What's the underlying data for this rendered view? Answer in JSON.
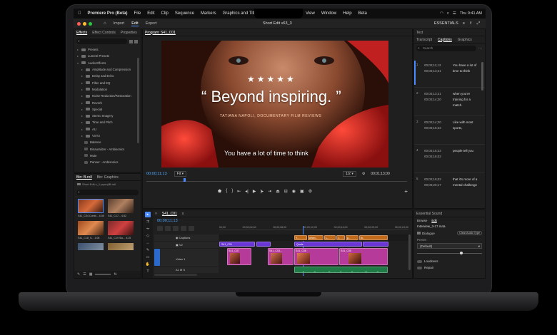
{
  "menubar": {
    "app": "Premiere Pro (Beta)",
    "items": [
      "File",
      "Edit",
      "Clip",
      "Sequence",
      "Markers",
      "Graphics and Titles",
      "View",
      "Window",
      "Help",
      "Beta"
    ],
    "clock": "Thu 9:41 AM",
    "essentials": "ESSENTIALS"
  },
  "titlebar": {
    "tabs": [
      "Import",
      "Edit",
      "Export"
    ],
    "document": "Short Edit v63_3"
  },
  "effects": {
    "tabs": [
      "Effects",
      "Effect Controls",
      "Properties"
    ],
    "search_placeholder": "",
    "tree": [
      "Presets",
      "Lumetri Presets",
      "Audio Effects",
      "Amplitude and Compression",
      "Delay and Echo",
      "Filter and EQ",
      "Modulation",
      "Noise Reduction/Restoration",
      "Reverb",
      "Special",
      "Stereo Imagery",
      "Time and Pitch",
      "AU",
      "VST3",
      "Balance",
      "Binauralizer - Ambisonics",
      "Mute",
      "Panner - Ambisonics"
    ]
  },
  "bins": {
    "tabs": [
      "Bin: B-roll",
      "Bin: Graphics"
    ],
    "path": "Short Edit v_1.prproj\\B-roll",
    "clips": [
      {
        "name": "S41_C04 Comb...",
        "dur": "4:08"
      },
      {
        "name": "S41_C17...",
        "dur": "4:52"
      },
      {
        "name": "S41_C18_S...",
        "dur": "1:06"
      },
      {
        "name": "S41_C19 Slo...",
        "dur": "4:15"
      },
      {
        "name": "S41_C22...",
        "dur": ""
      },
      {
        "name": "S41_C23...",
        "dur": ""
      }
    ]
  },
  "program": {
    "tab": "Program: S41_C01",
    "stars": "★★★★★",
    "headline": "“ Beyond inspiring. ”",
    "subline": "TATIANA NAPOLI, DOCUMENTARY FILM REVIEWS",
    "caption": "You have a lot of time to think",
    "timecode_in": "00;00;11;13",
    "fit": "Fit",
    "resolution": "1/2",
    "timecode_dur": "00;01;13;00"
  },
  "timeline": {
    "tab": "S41_C01",
    "timecode": "00;00;11;13",
    "ruler": [
      "00;00",
      "00;00;04;00",
      "00;00;08;00",
      "00;00;12;00",
      "00;00;16;00",
      "00;00;20;00",
      "00;00;24;00"
    ],
    "tracks": {
      "captions": "Captions",
      "v2": "V2",
      "v1": "Video 1",
      "a1": "A1"
    },
    "caption_chips": [
      "Y...",
      "when..",
      "L..",
      "I..",
      "p..",
      "th.."
    ],
    "clips_v2": [
      "S41_C01",
      "Quote"
    ],
    "clips_v1": [
      "S41_C07",
      "S41_C03...",
      "S41_C06",
      "S41_C05"
    ]
  },
  "captions": {
    "tabs": [
      "Text",
      "Transcript",
      "Captions",
      "Graphics"
    ],
    "search": "Search",
    "rows": [
      {
        "n": "1",
        "tin": "00;00;11;13",
        "tout": "00;00;13;21",
        "text": "You have a lot of time to think"
      },
      {
        "n": "2",
        "tin": "00;00;13;21",
        "tout": "00;00;14;20",
        "text": "when you're training for a match."
      },
      {
        "n": "3",
        "tin": "00;00;14;20",
        "tout": "00;00;15;23",
        "text": "Like with most sports,"
      },
      {
        "n": "4",
        "tin": "00;00;15;23",
        "tout": "00;00;18;03",
        "text": "people tell you"
      },
      {
        "n": "5",
        "tin": "00;00;18;03",
        "tout": "00;00;20;17",
        "text": "that it's more of a mental challenge"
      }
    ]
  },
  "essential_sound": {
    "title": "Essential Sound",
    "tabs": [
      "Browse",
      "Edit"
    ],
    "file": "Interview_3-17.m4a",
    "type": "Dialogue",
    "clear": "Clear Audio Type",
    "preset_label": "Preset",
    "preset": "(Default)",
    "loudness": "Loudness",
    "repair": "Repair"
  },
  "colors": {
    "accent": "#4a8cff",
    "video_clip": "#b63a9a",
    "graphic_clip": "#6a36d6",
    "caption_track": "#c06a1a",
    "audio_clip": "#1f7a45"
  }
}
